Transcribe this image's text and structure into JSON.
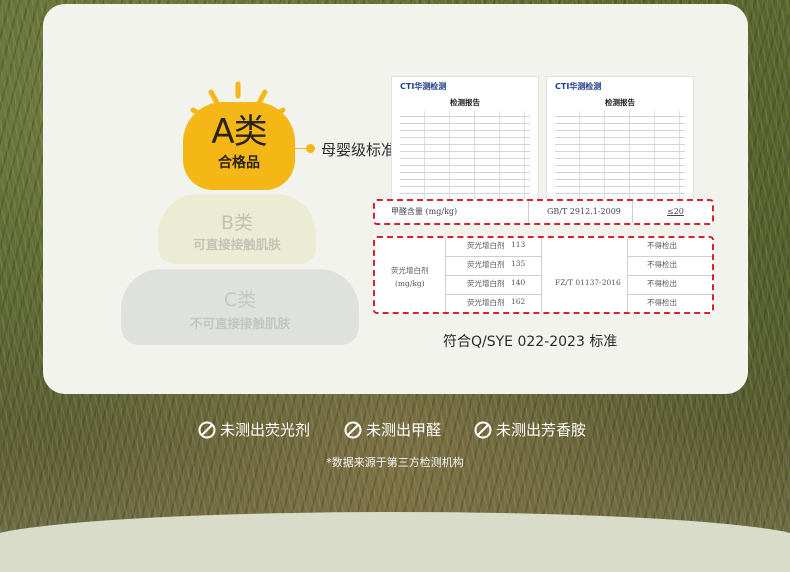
{
  "pyramid": {
    "a": {
      "main": "A类",
      "sub": "合格品"
    },
    "b": {
      "main": "B类",
      "sub": "可直接接触肌肤"
    },
    "c": {
      "main": "C类",
      "sub": "不可直接接触肌肤"
    },
    "callout": "母婴级标准"
  },
  "reports": {
    "logo": "CTI华测检测",
    "title": "检测报告"
  },
  "table_formaldehyde": {
    "item": "甲醛含量 (mg/kg)",
    "standard": "GB/T 2912.1-2009",
    "result": "≤20"
  },
  "table_fluorescent": {
    "item": "荧光增白剂",
    "unit": "(mg/kg)",
    "rows": [
      {
        "name": "荧光增白剂",
        "value": "113",
        "result": "不得检出"
      },
      {
        "name": "荧光增白剂",
        "value": "135",
        "result": "不得检出"
      },
      {
        "name": "荧光增白剂",
        "value": "140",
        "result": "不得检出"
      },
      {
        "name": "荧光增白剂",
        "value": "162",
        "result": "不得检出"
      }
    ],
    "standard": "FZ/T 01137-2016"
  },
  "standard_caption": "符合Q/SYE 022-2023 标准",
  "claims": [
    "未测出荧光剂",
    "未测出甲醛",
    "未测出芳香胺"
  ],
  "footnote": "*数据来源于第三方检测机构",
  "colors": {
    "accent": "#f5b716",
    "dash": "#d7232e"
  }
}
